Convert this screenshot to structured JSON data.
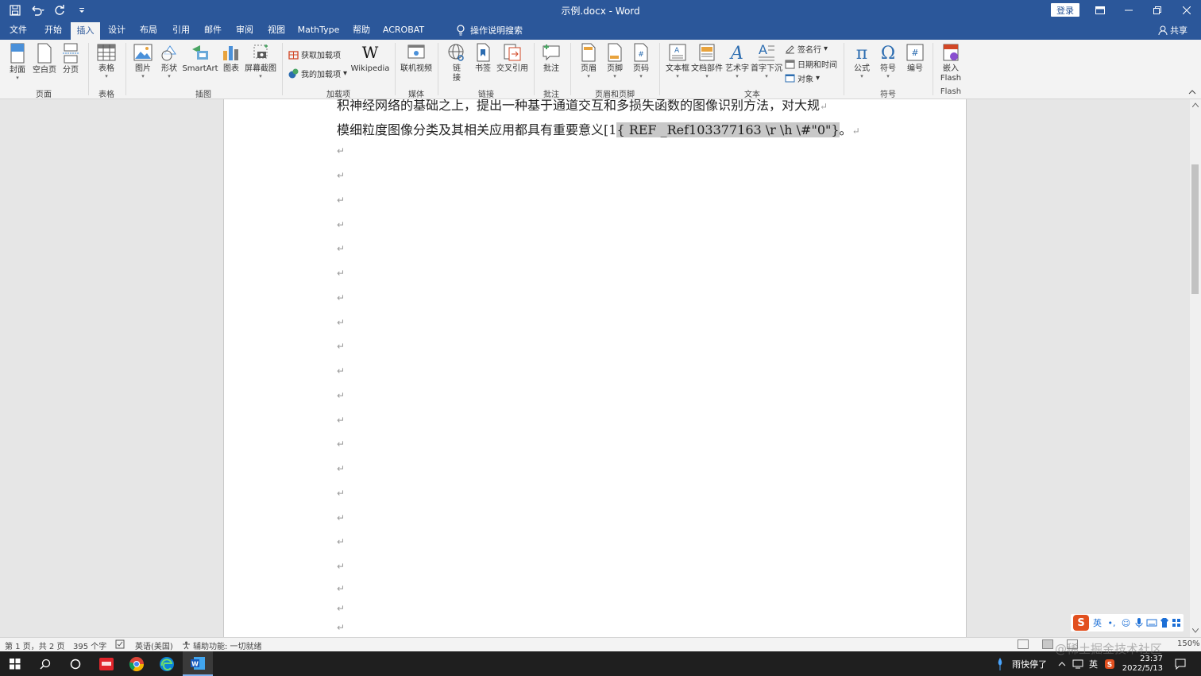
{
  "window": {
    "title": "示例.docx  -  Word",
    "login_label": "登录",
    "share_label": "共享",
    "tell_me": "操作说明搜索"
  },
  "tabs": [
    "文件",
    "开始",
    "插入",
    "设计",
    "布局",
    "引用",
    "邮件",
    "审阅",
    "视图",
    "MathType",
    "帮助",
    "ACROBAT"
  ],
  "active_tab": "插入",
  "ribbon": {
    "groups": {
      "pages": "页面",
      "tables": "表格",
      "illustrations": "插图",
      "addins": "加载项",
      "media": "媒体",
      "links": "链接",
      "comments": "批注",
      "header_footer": "页眉和页脚",
      "text": "文本",
      "symbols": "符号",
      "flash": "Flash"
    },
    "buttons": {
      "cover": "封面",
      "blank_page": "空白页",
      "page_break": "分页",
      "table": "表格",
      "picture": "图片",
      "shapes": "形状",
      "smartart": "SmartArt",
      "chart": "图表",
      "screenshot": "屏幕截图",
      "get_addins": "获取加载项",
      "my_addins": "我的加载项",
      "wikipedia": "Wikipedia",
      "online_video": "联机视频",
      "link_1": "链",
      "link_2": "接",
      "bookmark": "书签",
      "cross_ref": "交叉引用",
      "comment": "批注",
      "header": "页眉",
      "footer": "页脚",
      "page_number": "页码",
      "text_box": "文本框",
      "quick_parts": "文档部件",
      "wordart": "艺术字",
      "drop_cap": "首字下沉",
      "signature_line": "签名行",
      "date_time": "日期和时间",
      "object": "对象",
      "equation": "公式",
      "symbol": "符号",
      "numbering": "编号",
      "embed_flash_1": "嵌入",
      "embed_flash_2": "Flash"
    }
  },
  "document": {
    "line1": "积神经网络的基础之上，提出一种基于通道交互和多损失函数的图像识别方法，对大规",
    "line2_text": "模细粒度图像分类及其相关应用都具有重要意义[1",
    "line2_field": "{ REF _Ref103377163 \\r \\h \\#\"0\"}",
    "line2_end": "。",
    "para_mark": "↵"
  },
  "status": {
    "page": "第 1 页，共 2 页",
    "words": "395 个字",
    "language": "英语(美国)",
    "accessibility": "辅助功能: 一切就绪",
    "zoom": "150%"
  },
  "ime": {
    "lang": "英",
    "punct": "•,"
  },
  "taskbar": {
    "weather": "雨快停了",
    "ime_lang": "英",
    "time": "23:37",
    "date": "2022/5/13"
  },
  "watermark": "@稀土掘金技术社区"
}
